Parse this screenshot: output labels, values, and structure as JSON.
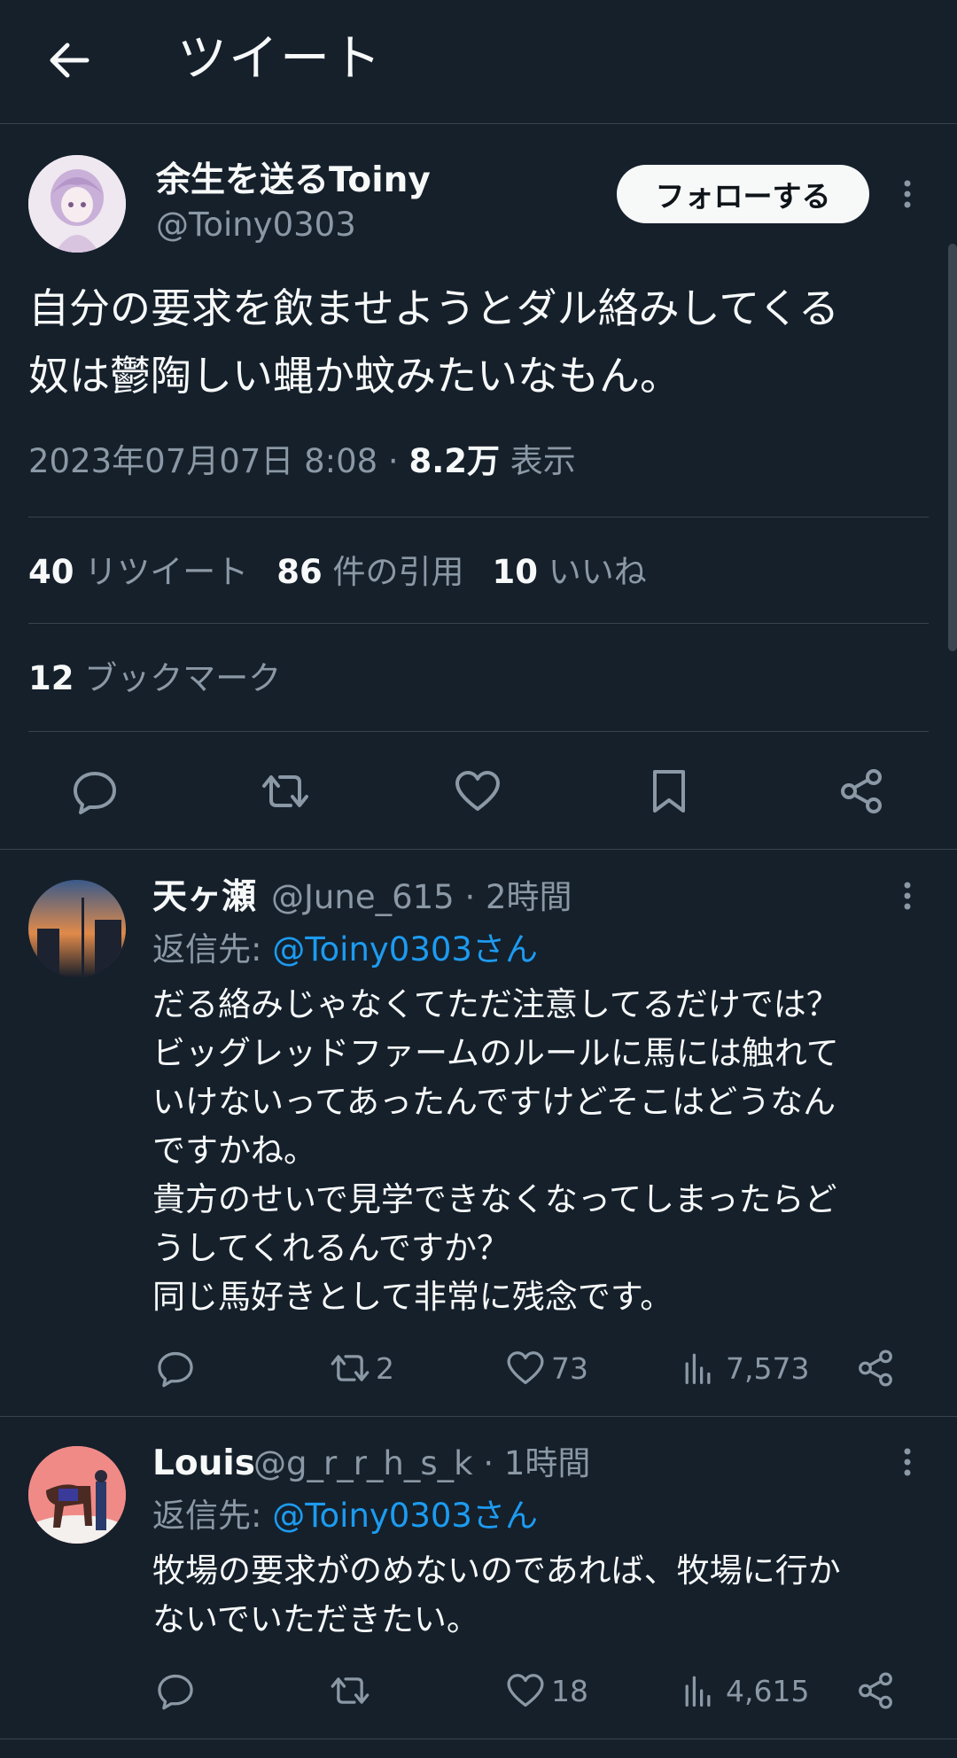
{
  "header": {
    "title": "ツイート",
    "back_icon": "arrow-left-icon"
  },
  "tweet": {
    "display_name": "余生を送るToiny",
    "handle": "@Toiny0303",
    "follow_label": "フォローする",
    "text": "自分の要求を飲ませようとダル絡みしてくる\n奴は鬱陶しい蝿か蚊みたいなもん。",
    "timestamp": "2023年07月07日 8:08 · ",
    "views_count": "8.2万",
    "views_label": " 表示",
    "stats": {
      "retweets_count": "40",
      "retweets_label": " リツイート",
      "quotes_count": "86",
      "quotes_label": " 件の引用",
      "likes_count": "10",
      "likes_label": " いいね"
    },
    "bookmarks_count": "12",
    "bookmarks_label": " ブックマーク"
  },
  "replies": [
    {
      "display_name": "天ヶ瀬",
      "meta": "@June_615 · 2時間",
      "reply_to_prefix": "返信先: ",
      "reply_to_mention": "@Toiny0303さん",
      "text": "だる絡みじゃなくてただ注意してるだけでは？\nビッグレッドファームのルールに馬には触れて\nいけないってあったんですけどそこはどうなん\nですかね。\n貴方のせいで見学できなくなってしまったらど\nうしてくれるんですか？\n同じ馬好きとして非常に残念です。",
      "retweets": "2",
      "likes": "73",
      "views": "7,573"
    },
    {
      "display_name": "Louis",
      "meta": "@g_r_r_h_s_k · 1時間",
      "reply_to_prefix": "返信先: ",
      "reply_to_mention": "@Toiny0303さん",
      "text": "牧場の要求がのめないのであれば、牧場に行か\nないでいただきたい。",
      "retweets": "",
      "likes": "18",
      "views": "4,615"
    }
  ],
  "colors": {
    "background": "#15202b",
    "text_primary": "#f7f9f9",
    "text_secondary": "#8b98a5",
    "link": "#1d9bf0",
    "divider": "#38444d"
  }
}
